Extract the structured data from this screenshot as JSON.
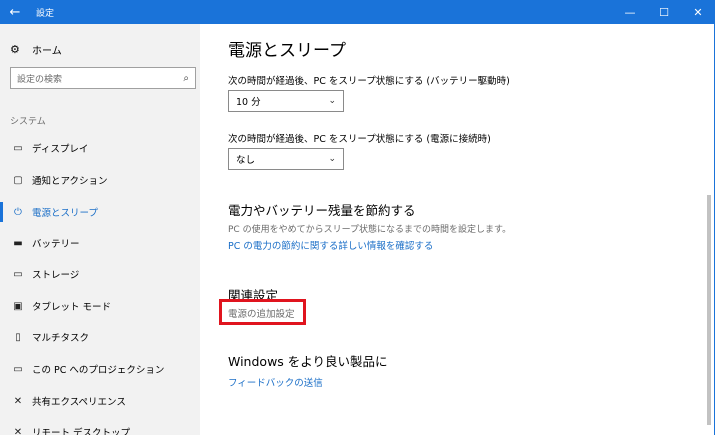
{
  "window": {
    "title": "設定",
    "back_glyph": "←",
    "minimize_glyph": "—",
    "maximize_glyph": "☐",
    "close_glyph": "✕"
  },
  "sidebar": {
    "home_label": "ホーム",
    "home_icon": "⚙",
    "search_placeholder": "設定の検索",
    "search_icon": "⌕",
    "section_label": "システム",
    "items": [
      {
        "label": "ディスプレイ",
        "icon": "▭"
      },
      {
        "label": "通知とアクション",
        "icon": "▢"
      },
      {
        "label": "電源とスリープ",
        "icon": "⏻"
      },
      {
        "label": "バッテリー",
        "icon": "▬"
      },
      {
        "label": "ストレージ",
        "icon": "▭"
      },
      {
        "label": "タブレット モード",
        "icon": "▣"
      },
      {
        "label": "マルチタスク",
        "icon": "▯"
      },
      {
        "label": "この PC へのプロジェクション",
        "icon": "▭"
      },
      {
        "label": "共有エクスペリエンス",
        "icon": "✕"
      },
      {
        "label": "リモート デスクトップ",
        "icon": "✕"
      }
    ],
    "selected_index": 2
  },
  "main": {
    "page_title": "電源とスリープ",
    "battery_sleep_label": "次の時間が経過後、PC をスリープ状態にする (バッテリー駆動時)",
    "battery_sleep_value": "10 分",
    "plugged_sleep_label": "次の時間が経過後、PC をスリープ状態にする (電源に接続時)",
    "plugged_sleep_value": "なし",
    "chevron_glyph": "⌄",
    "save_heading": "電力やバッテリー残量を節約する",
    "save_desc": "PC の使用をやめてからスリープ状態になるまでの時間を設定します。",
    "save_link": "PC の電力の節約に関する詳しい情報を確認する",
    "related_heading": "関連設定",
    "related_link": "電源の追加設定",
    "better_heading": "Windows をより良い製品に",
    "feedback_link": "フィードバックの送信"
  },
  "colors": {
    "titlebar": "#1a73d9",
    "accent": "#1a6ec7",
    "highlight_box": "#e0141e",
    "sidebar_bg": "#f2f2f2"
  }
}
